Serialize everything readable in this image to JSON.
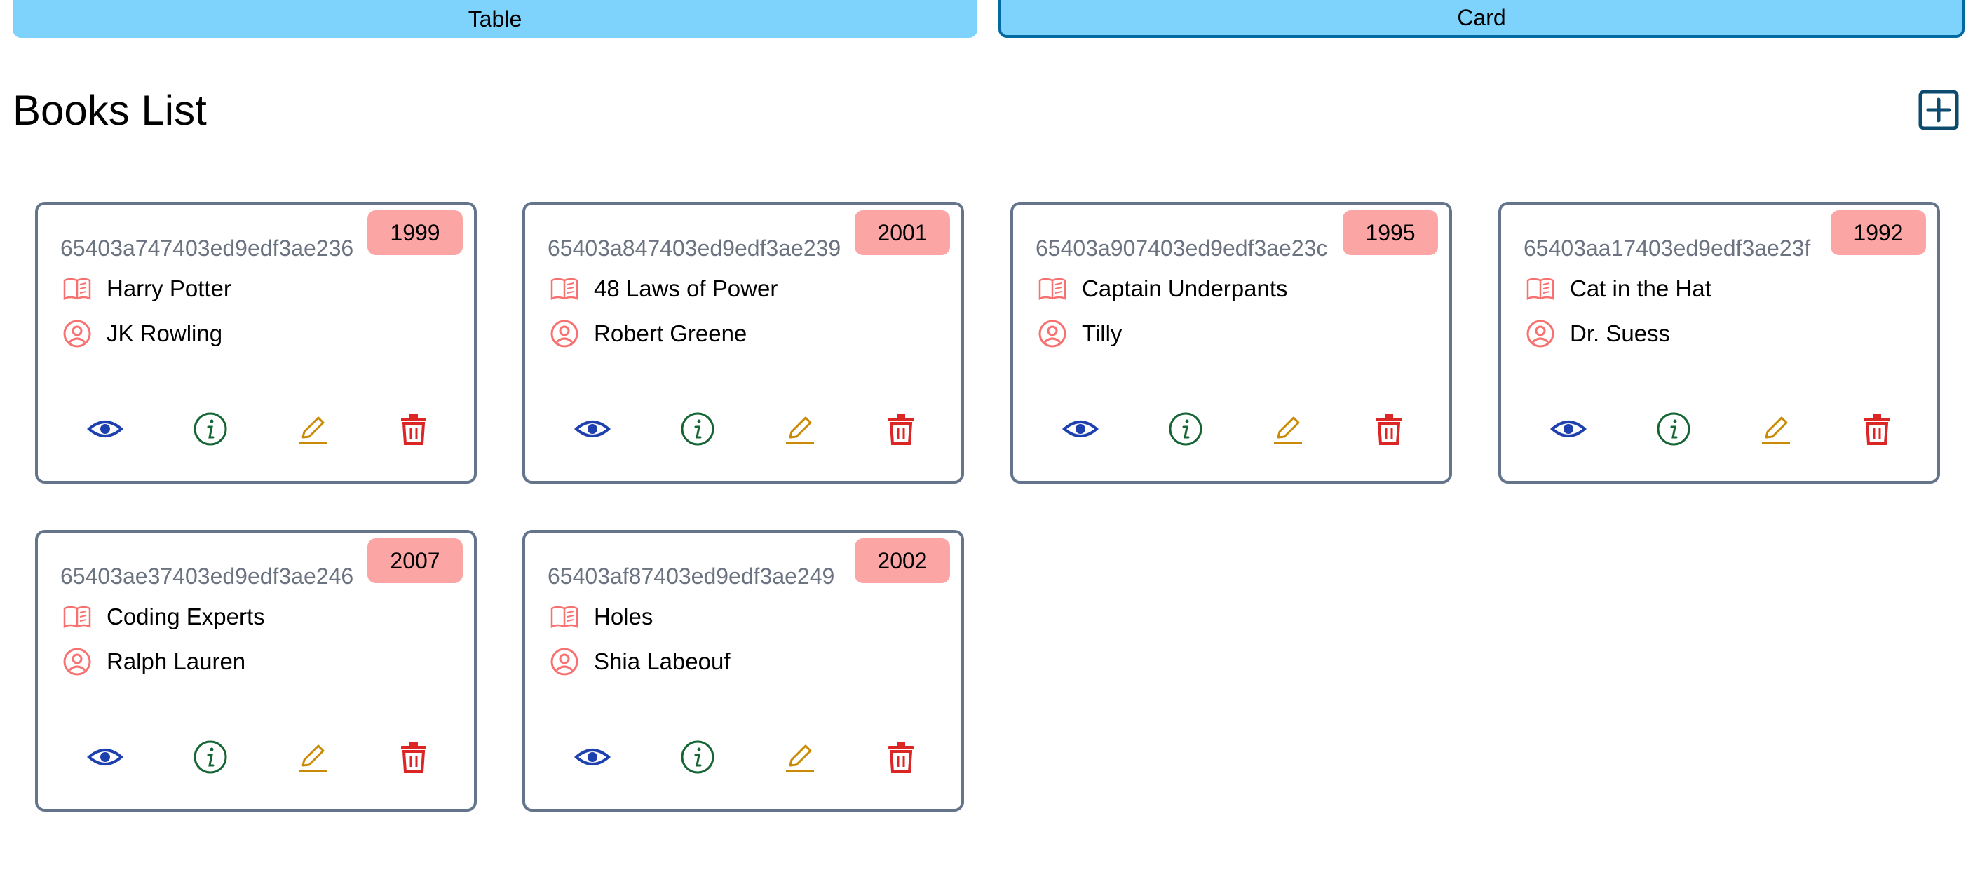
{
  "view_toggle": {
    "table_label": "Table",
    "card_label": "Card",
    "active": "Card"
  },
  "page": {
    "title": "Books List"
  },
  "colors": {
    "toggle": "#7dd3fc",
    "active_border": "#0369a1",
    "badge": "#fca5a5",
    "icon_pink": "#f87171",
    "view": "#1e40af",
    "info": "#166534",
    "edit": "#ca8a04",
    "delete": "#dc2626"
  },
  "icons": {
    "add": "plus-square-icon",
    "title": "book-open-icon",
    "author": "user-circle-icon",
    "view": "eye-icon",
    "info": "info-circle-icon",
    "edit": "pencil-icon",
    "delete": "trash-icon"
  },
  "books": [
    {
      "id": "65403a747403ed9edf3ae236",
      "year": "1999",
      "title": "Harry Potter",
      "author": "JK Rowling"
    },
    {
      "id": "65403a847403ed9edf3ae239",
      "year": "2001",
      "title": "48 Laws of Power",
      "author": "Robert Greene"
    },
    {
      "id": "65403a907403ed9edf3ae23c",
      "year": "1995",
      "title": "Captain Underpants",
      "author": "Tilly"
    },
    {
      "id": "65403aa17403ed9edf3ae23f",
      "year": "1992",
      "title": "Cat in the Hat",
      "author": "Dr. Suess"
    },
    {
      "id": "65403ae37403ed9edf3ae246",
      "year": "2007",
      "title": "Coding Experts",
      "author": "Ralph Lauren"
    },
    {
      "id": "65403af87403ed9edf3ae249",
      "year": "2002",
      "title": "Holes",
      "author": "Shia Labeouf"
    }
  ]
}
